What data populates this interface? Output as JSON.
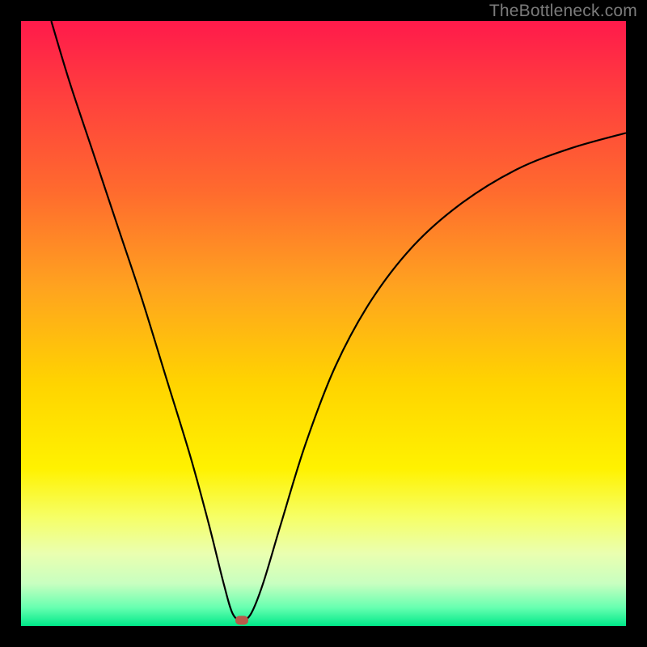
{
  "watermark": "TheBottleneck.com",
  "chart_data": {
    "type": "line",
    "title": "",
    "xlabel": "",
    "ylabel": "",
    "xlim": [
      0,
      100
    ],
    "ylim": [
      0,
      100
    ],
    "background_gradient": {
      "stops": [
        {
          "offset": 0.0,
          "color": "#ff1a4b"
        },
        {
          "offset": 0.12,
          "color": "#ff3e3e"
        },
        {
          "offset": 0.28,
          "color": "#ff6a2e"
        },
        {
          "offset": 0.44,
          "color": "#ffa31f"
        },
        {
          "offset": 0.6,
          "color": "#ffd400"
        },
        {
          "offset": 0.74,
          "color": "#fff200"
        },
        {
          "offset": 0.82,
          "color": "#f6ff66"
        },
        {
          "offset": 0.88,
          "color": "#eaffb0"
        },
        {
          "offset": 0.93,
          "color": "#c8ffc0"
        },
        {
          "offset": 0.97,
          "color": "#66ffb0"
        },
        {
          "offset": 1.0,
          "color": "#00e889"
        }
      ]
    },
    "marker": {
      "x": 36.5,
      "y": 1.0,
      "color": "#b85a4a"
    },
    "series": [
      {
        "name": "curve",
        "line_color": "#000000",
        "points": [
          {
            "x": 5.0,
            "y": 100.0
          },
          {
            "x": 8.0,
            "y": 90.0
          },
          {
            "x": 12.0,
            "y": 78.0
          },
          {
            "x": 16.0,
            "y": 66.0
          },
          {
            "x": 20.0,
            "y": 54.0
          },
          {
            "x": 24.0,
            "y": 41.0
          },
          {
            "x": 28.0,
            "y": 28.0
          },
          {
            "x": 31.0,
            "y": 17.0
          },
          {
            "x": 33.5,
            "y": 7.0
          },
          {
            "x": 35.0,
            "y": 2.0
          },
          {
            "x": 36.5,
            "y": 1.0
          },
          {
            "x": 38.0,
            "y": 2.0
          },
          {
            "x": 40.0,
            "y": 7.0
          },
          {
            "x": 43.0,
            "y": 17.0
          },
          {
            "x": 47.0,
            "y": 30.0
          },
          {
            "x": 52.0,
            "y": 43.0
          },
          {
            "x": 58.0,
            "y": 54.0
          },
          {
            "x": 65.0,
            "y": 63.0
          },
          {
            "x": 73.0,
            "y": 70.0
          },
          {
            "x": 82.0,
            "y": 75.5
          },
          {
            "x": 91.0,
            "y": 79.0
          },
          {
            "x": 100.0,
            "y": 81.5
          }
        ]
      }
    ]
  }
}
